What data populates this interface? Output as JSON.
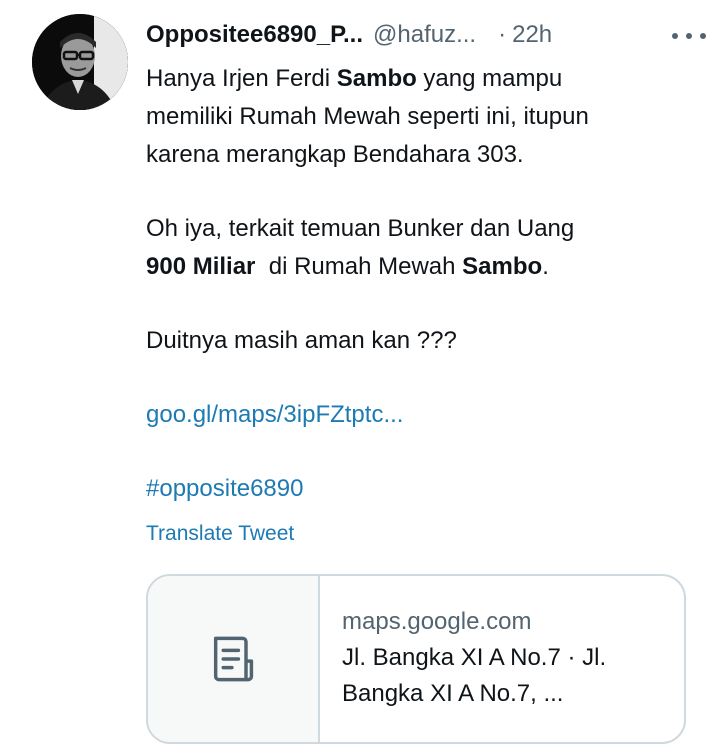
{
  "tweet": {
    "display_name": "Oppositee6890_P...",
    "handle": "@hafuz...",
    "separator": "·",
    "time": "22h",
    "more_icon": "more-horizontal-icon",
    "avatar_icon": "profile-photo",
    "body": {
      "line1_a": "Hanya Irjen Ferdi ",
      "line1_bold": "Sambo",
      "line1_b": " yang mampu",
      "line2": "memiliki Rumah Mewah seperti ini, itupun",
      "line3": "karena merangkap Bendahara 303.",
      "line4": "Oh iya, terkait temuan Bunker dan Uang",
      "line5_bold1": "900 Miliar",
      "line5_mid": "  di Rumah Mewah ",
      "line5_bold2": "Sambo",
      "line5_end": ".",
      "line6": "Duitnya masih aman kan ???",
      "link": "goo.gl/maps/3ipFZtptc...",
      "hashtag": "#opposite6890"
    },
    "translate_label": "Translate Tweet",
    "card": {
      "icon": "document-icon",
      "domain": "maps.google.com",
      "title_line1": "Jl. Bangka XI A No.7 · Jl.",
      "title_line2": "Bangka XI A No.7, ..."
    }
  }
}
